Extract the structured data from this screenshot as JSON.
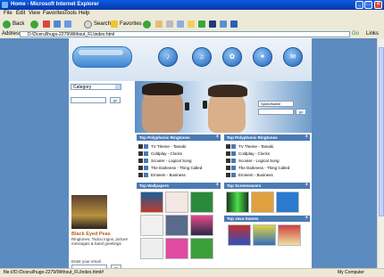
{
  "window": {
    "title": "Home - Microsoft Internet Explorer",
    "min": "_",
    "max": "□",
    "close": "×"
  },
  "menu": [
    "File",
    "Edit",
    "View",
    "Favorites",
    "Tools",
    "Help"
  ],
  "toolbar": {
    "back": "Back",
    "search": "Search",
    "favorites": "Favorites"
  },
  "address": {
    "label": "Address",
    "value": "D:\\Dcerul\\hugo-2279\\Without_FL\\index.html",
    "go": "Go",
    "links": "Links"
  },
  "status": {
    "left": "file:///D:/Dcerul/hugo-2279/Without_FL/index.html#",
    "right": "My Computer"
  },
  "sidebar": {
    "category_select": "Category",
    "go1": "go",
    "bpp_title": "Black Eyed Peas",
    "bpp_text": "Ringtones, Todou logos, picture messages & band greetings",
    "email_label": "Enter your email",
    "go2": "go"
  },
  "search": {
    "value": "SpeedName",
    "go": "go"
  },
  "sections": {
    "poly1": {
      "title": "Top Polyphonic Ringtones",
      "items": [
        "TV Theme - Tamaki",
        "Coldplay - Clocks",
        "Scooter - Logical Song",
        "The Darkness - Thing Called",
        "Eminem - Business"
      ]
    },
    "poly2": {
      "title": "Top Polyphonic Ringtones",
      "items": [
        "TV Theme - Tamaki",
        "Coldplay - Clocks",
        "Scooter - Logical Song",
        "The Darkness - Thing Called",
        "Eminem - Business"
      ]
    },
    "wallpapers": {
      "title": "Top Wallpapers"
    },
    "screensavers": {
      "title": "Top Screensavers"
    },
    "java": {
      "title": "Top Java Games"
    }
  },
  "colors": {
    "accent": "#4b7ab3",
    "brand": "#2f6fb5"
  }
}
